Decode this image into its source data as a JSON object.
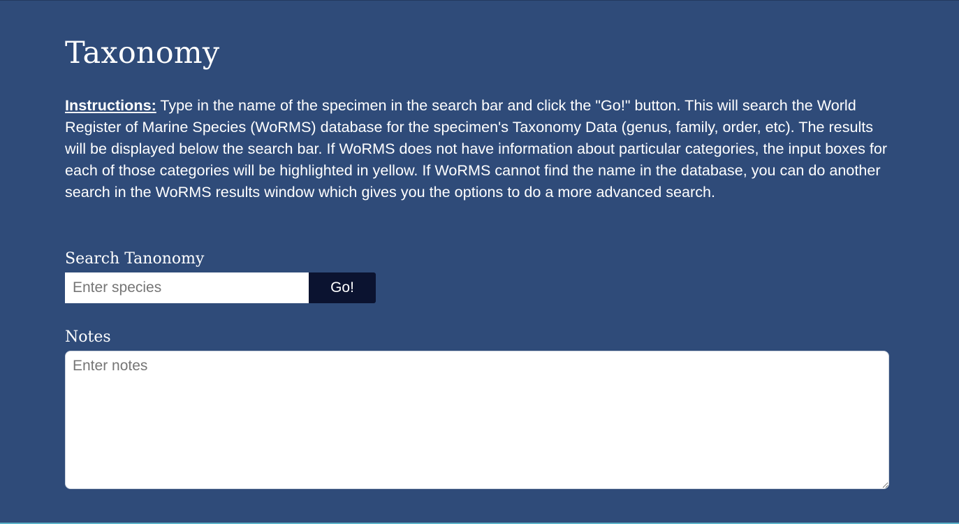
{
  "page": {
    "title": "Taxonomy"
  },
  "instructions": {
    "lead": "Instructions:",
    "body": "Type in the name of the specimen in the search bar and click the \"Go!\" button. This will search the World Register of Marine Species (WoRMS) database for the specimen's Taxonomy Data (genus, family, order, etc). The results will be displayed below the search bar. If WoRMS does not have information about particular categories, the input boxes for each of those categories will be highlighted in yellow. If WoRMS cannot find the name in the database, you can do another search in the WoRMS results window which gives you the options to do a more advanced search."
  },
  "search": {
    "label": "Search Tanonomy",
    "placeholder": "Enter species",
    "value": "",
    "button_label": "Go!"
  },
  "notes": {
    "label": "Notes",
    "placeholder": "Enter notes",
    "value": ""
  },
  "colors": {
    "background": "#2f4b79",
    "button": "#0b1330",
    "text": "#ffffff"
  }
}
